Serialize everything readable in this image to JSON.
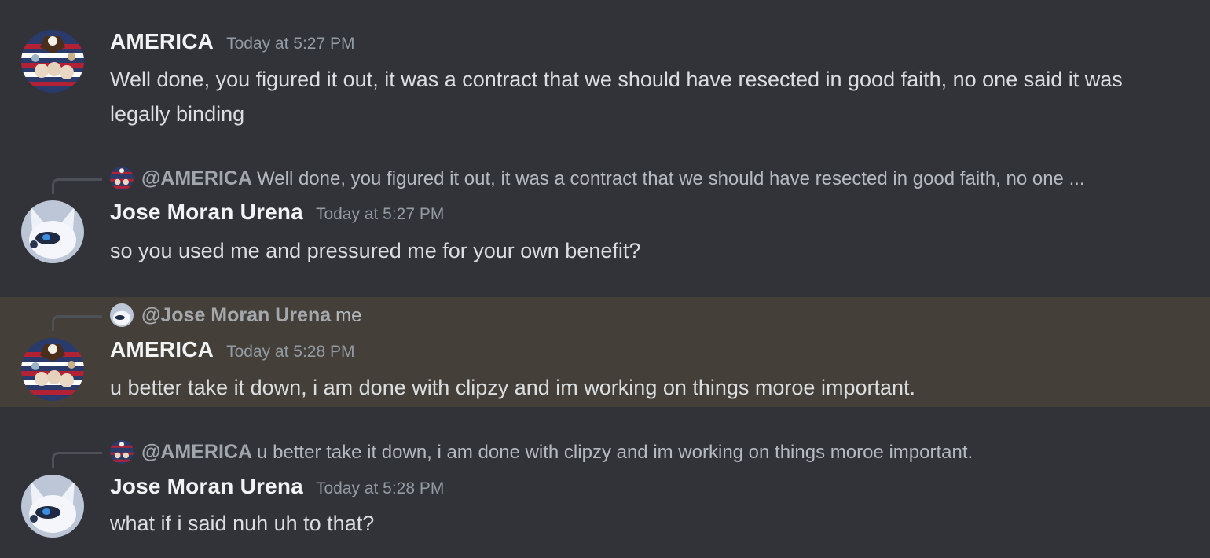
{
  "messages": [
    {
      "author": "AMERICA",
      "timestamp": "Today at 5:27 PM",
      "text": "Well done, you figured it out, it was a contract that we should have resected in good faith, no one said it was legally binding",
      "reply": null,
      "highlighted": false
    },
    {
      "author": "Jose Moran Urena",
      "timestamp": "Today at 5:27 PM",
      "text": "so you used me and pressured me for your own benefit?",
      "reply": {
        "mention": "@AMERICA",
        "snippet": "Well done, you figured it out, it was a contract that we should have resected in good faith, no one ..."
      },
      "highlighted": false
    },
    {
      "author": "AMERICA",
      "timestamp": "Today at 5:28 PM",
      "text": "u better take it down, i am done with clipzy and im working on things moroe important.",
      "reply": {
        "mention": "@Jose Moran Urena",
        "snippet": "me"
      },
      "highlighted": true
    },
    {
      "author": "Jose Moran Urena",
      "timestamp": "Today at 5:28 PM",
      "text": "what if i said nuh uh to that?",
      "reply": {
        "mention": "@AMERICA",
        "snippet": "u better take it down, i am done with clipzy and im working on things moroe important."
      },
      "highlighted": false
    }
  ],
  "avatars": {
    "america": "patriotic-collage-avatar",
    "jose": "white-fox-avatar"
  },
  "colors": {
    "background": "#313338",
    "highlight": "#444039",
    "username": "#f2f3f5",
    "text": "#dbdee1",
    "muted": "#949ba4"
  }
}
